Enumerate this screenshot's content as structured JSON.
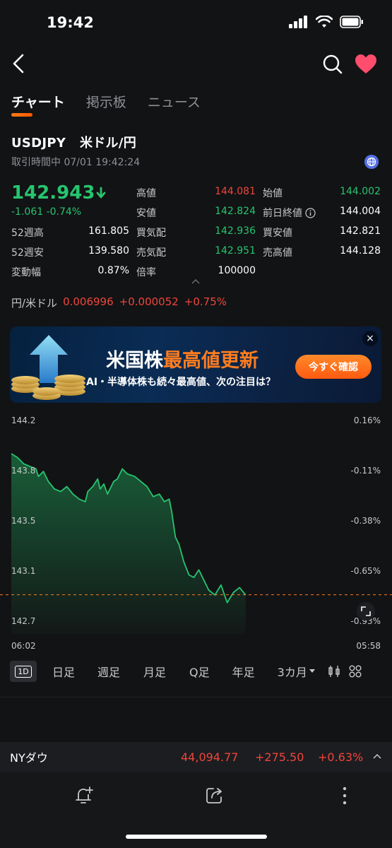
{
  "status": {
    "time": "19:42"
  },
  "tabs": [
    {
      "label": "チャート",
      "active": true
    },
    {
      "label": "掲示板",
      "active": false
    },
    {
      "label": "ニュース",
      "active": false
    }
  ],
  "instrument": {
    "symbol": "USDJPY",
    "name": "米ドル/円",
    "session": "取引時間中 07/01 19:42:24",
    "price": "142.943",
    "change": "-1.061 -0.74%"
  },
  "stats": [
    {
      "label": "高値",
      "value": "144.081",
      "color": "red"
    },
    {
      "label": "始値",
      "value": "144.002",
      "color": "green"
    },
    {
      "label": "安値",
      "value": "142.824",
      "color": "green"
    },
    {
      "label": "前日終値",
      "value": "144.004",
      "color": "white"
    },
    {
      "label": "52週高",
      "value": "161.805",
      "color": "white"
    },
    {
      "label": "買気配",
      "value": "142.936",
      "color": "green"
    },
    {
      "label": "買安値",
      "value": "142.821",
      "color": "white"
    },
    {
      "label": "52週安",
      "value": "139.580",
      "color": "white"
    },
    {
      "label": "売気配",
      "value": "142.951",
      "color": "green"
    },
    {
      "label": "売高値",
      "value": "144.128",
      "color": "white"
    },
    {
      "label": "変動幅",
      "value": "0.87%",
      "color": "white"
    },
    {
      "label": "倍率",
      "value": "100000",
      "color": "white"
    }
  ],
  "cross_rate": {
    "label": "円/米ドル",
    "price": "0.006996",
    "change": "+0.000052",
    "pct": "+0.75%"
  },
  "banner": {
    "title_white": "米国株",
    "title_orange": "最高値更新",
    "subtitle": "AI・半導体株も続々最高値、次の注目は？",
    "button": "今すぐ確認",
    "close": "×"
  },
  "chart_data": {
    "type": "line",
    "y_ticks": [
      "144.2",
      "143.8",
      "143.5",
      "143.1",
      "142.7"
    ],
    "pct_ticks": [
      "0.16%",
      "-0.11%",
      "-0.38%",
      "-0.65%",
      "-0.93%"
    ],
    "x_start": "06:02",
    "x_end": "05:58",
    "ylim": [
      142.7,
      144.2
    ],
    "prev_close": 144.004,
    "current": 142.943,
    "x": [
      0,
      0.05,
      0.1,
      0.15,
      0.2,
      0.22,
      0.26,
      0.3,
      0.35,
      0.4,
      0.45,
      0.5,
      0.55,
      0.6,
      0.62,
      0.66,
      0.7,
      0.72,
      0.75,
      0.78,
      0.8,
      0.83,
      0.86,
      0.9,
      0.94,
      1.0,
      1.05,
      1.1,
      1.15,
      1.2,
      1.24,
      1.28,
      1.3,
      1.33,
      1.36,
      1.4,
      1.44,
      1.48,
      1.52,
      1.56,
      1.6,
      1.65,
      1.7,
      1.75,
      1.8,
      1.85,
      1.9
    ],
    "values": [
      144.06,
      144.03,
      143.98,
      143.96,
      143.94,
      143.88,
      143.92,
      143.84,
      143.78,
      143.76,
      143.8,
      143.74,
      143.7,
      143.68,
      143.76,
      143.8,
      143.86,
      143.78,
      143.82,
      143.74,
      143.78,
      143.84,
      143.86,
      143.94,
      143.9,
      143.88,
      143.84,
      143.8,
      143.72,
      143.74,
      143.68,
      143.7,
      143.6,
      143.4,
      143.34,
      143.2,
      143.1,
      143.08,
      143.14,
      143.06,
      142.98,
      142.94,
      143.02,
      142.88,
      142.96,
      143.0,
      142.94
    ]
  },
  "periods": [
    "1D",
    "日足",
    "週足",
    "月足",
    "Q足",
    "年足",
    "3カ月"
  ],
  "ticker": {
    "name": "NYダウ",
    "price": "44,094.77",
    "change": "+275.50",
    "pct": "+0.63%"
  },
  "colors": {
    "up": "#f0453a",
    "down": "#27c46f",
    "accent": "#ff6a10"
  }
}
